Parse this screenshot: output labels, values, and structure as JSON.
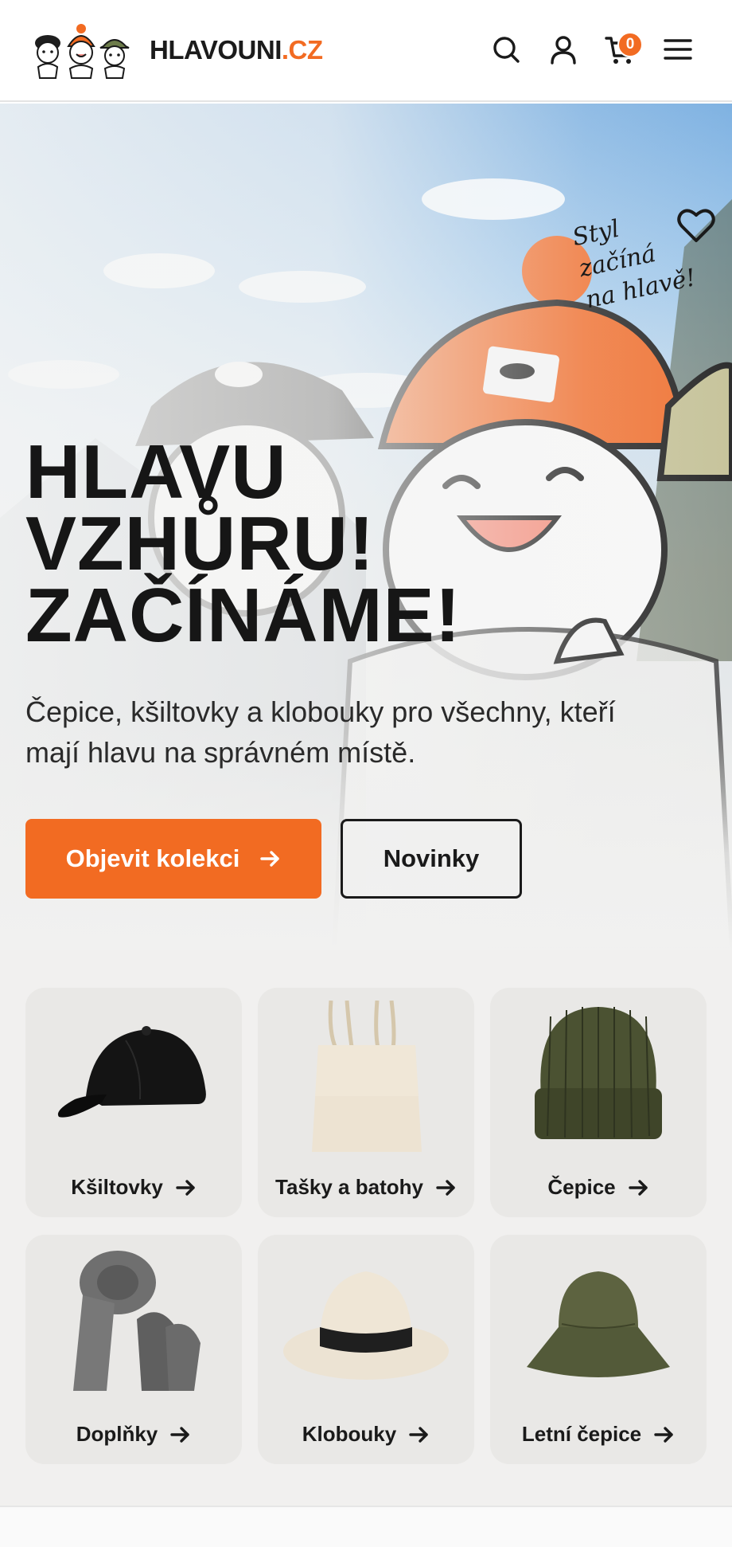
{
  "header": {
    "brand_main": "HLAVOUNI",
    "brand_suffix": ".CZ",
    "cart_count": "0",
    "icons": [
      "search-icon",
      "user-icon",
      "cart-icon",
      "menu-icon"
    ]
  },
  "hero": {
    "slogan": [
      "Styl",
      "začíná",
      "na hlavě!"
    ],
    "title_lines": [
      "HLAVU",
      "VZHŮRU!",
      "ZAČÍNÁME!"
    ],
    "subtitle": "Čepice, kšiltovky a klobouky pro všechny, kteří mají hlavu na správném místě.",
    "primary_button": "Objevit kolekci",
    "secondary_button": "Novinky"
  },
  "categories": [
    {
      "label": "Kšiltovky",
      "icon": "cap-image"
    },
    {
      "label": "Tašky a batohy",
      "icon": "tote-bag-image"
    },
    {
      "label": "Čepice",
      "icon": "beanie-image"
    },
    {
      "label": "Doplňky",
      "icon": "scarf-gloves-image"
    },
    {
      "label": "Klobouky",
      "icon": "fedora-image"
    },
    {
      "label": "Letní čepice",
      "icon": "bucket-hat-image"
    }
  ],
  "colors": {
    "accent": "#f26b22",
    "text": "#1a1a1a",
    "card_bg": "#e9e8e6"
  }
}
